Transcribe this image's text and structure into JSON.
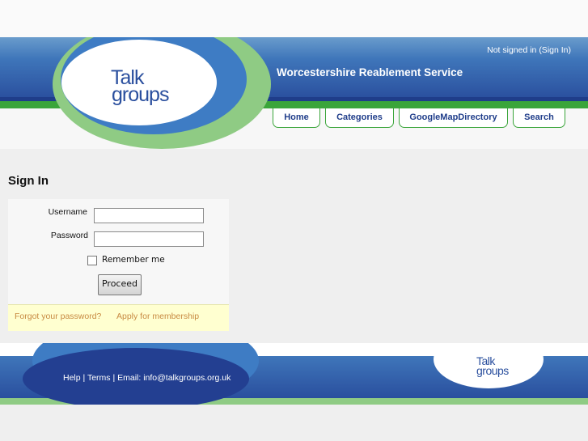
{
  "header": {
    "signin_status": "Not signed in (Sign In)",
    "site_title": "Worcestershire Reablement Service",
    "logo_line1": "Talk",
    "logo_line2": "groups",
    "nav": [
      {
        "label": "Home"
      },
      {
        "label": "Categories"
      },
      {
        "label": "GoogleMapDirectory"
      },
      {
        "label": "Search"
      }
    ]
  },
  "main": {
    "title": "Sign In",
    "form": {
      "username_label": "Username",
      "username_value": "",
      "password_label": "Password",
      "password_value": "",
      "remember_label": "Remember me",
      "remember_checked": false,
      "proceed_label": "Proceed",
      "forgot_link": "Forgot your password?",
      "apply_link": "Apply for membership"
    }
  },
  "footer": {
    "links": "Help | Terms | Email: info@talkgroups.org.uk",
    "logo_line1": "Talk",
    "logo_line2": "groups"
  },
  "colors": {
    "brand_blue": "#2a4f9e",
    "dark_blue": "#233f91",
    "brand_green": "#3aa53a",
    "link_orange": "#c88a42"
  }
}
